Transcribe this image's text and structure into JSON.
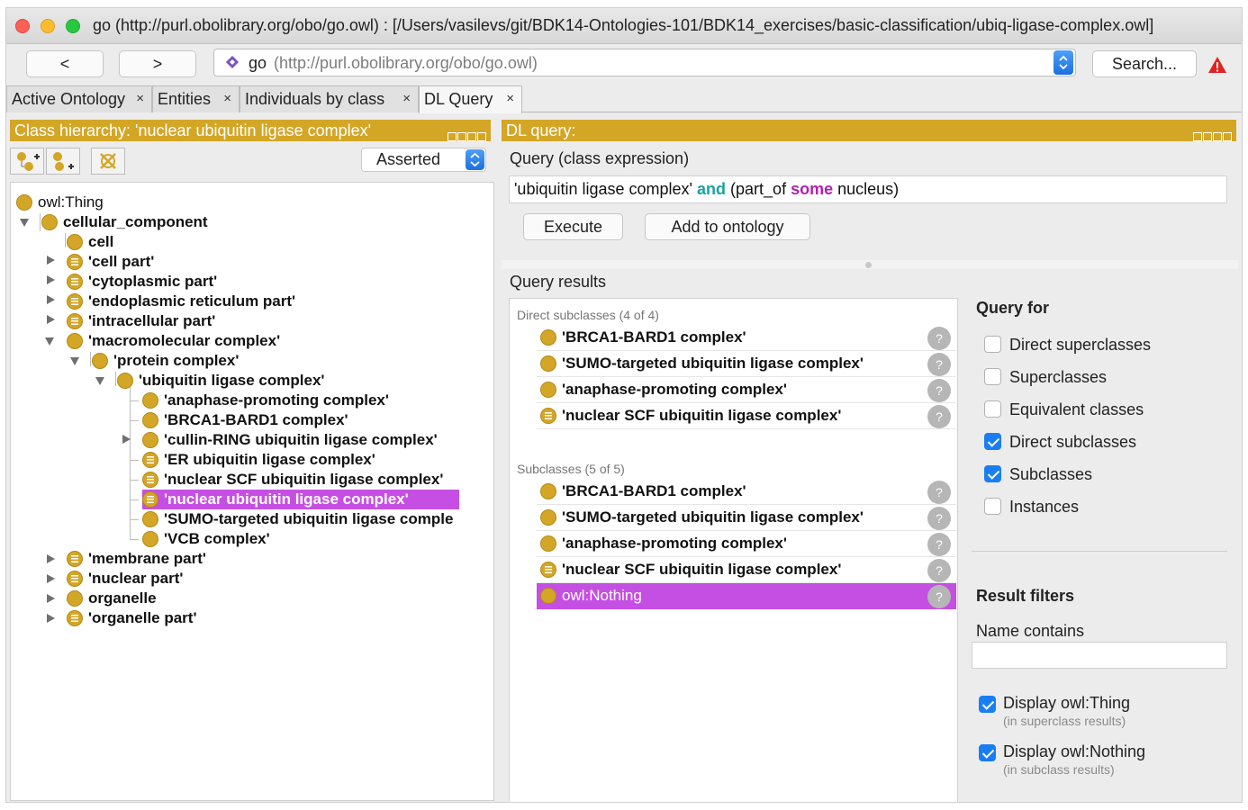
{
  "window": {
    "title": "go (http://purl.obolibrary.org/obo/go.owl)  : [/Users/vasilevs/git/BDK14-Ontologies-101/BDK14_exercises/basic-classification/ubiq-ligase-complex.owl]"
  },
  "nav": {
    "back_label": "<",
    "forward_label": ">",
    "ontology_name": "go",
    "ontology_iri": "(http://purl.obolibrary.org/obo/go.owl)",
    "search_label": "Search..."
  },
  "tabs": [
    {
      "label": "Active Ontology",
      "close": "×"
    },
    {
      "label": "Entities",
      "close": "×"
    },
    {
      "label": "Individuals by class",
      "close": "×"
    },
    {
      "label": "DL Query",
      "close": "×"
    }
  ],
  "class_hierarchy": {
    "header": "Class hierarchy: 'nuclear ubiquitin ligase complex'",
    "mode": "Asserted",
    "nodes": [
      {
        "label": "owl:Thing"
      },
      {
        "label": "cellular_component"
      },
      {
        "label": "cell"
      },
      {
        "label": "'cell part'"
      },
      {
        "label": "'cytoplasmic part'"
      },
      {
        "label": "'endoplasmic reticulum part'"
      },
      {
        "label": "'intracellular part'"
      },
      {
        "label": "'macromolecular complex'"
      },
      {
        "label": "'protein complex'"
      },
      {
        "label": "'ubiquitin ligase complex'"
      },
      {
        "label": "'anaphase-promoting complex'"
      },
      {
        "label": "'BRCA1-BARD1 complex'"
      },
      {
        "label": "'cullin-RING ubiquitin ligase complex'"
      },
      {
        "label": "'ER ubiquitin ligase complex'"
      },
      {
        "label": "'nuclear SCF ubiquitin ligase complex'"
      },
      {
        "label": "'nuclear ubiquitin ligase complex'"
      },
      {
        "label": "'SUMO-targeted ubiquitin ligase comple"
      },
      {
        "label": "'VCB complex'"
      },
      {
        "label": "'membrane part'"
      },
      {
        "label": "'nuclear part'"
      },
      {
        "label": "organelle"
      },
      {
        "label": "'organelle part'"
      }
    ]
  },
  "dl_query": {
    "header": "DL query:",
    "expression_label": "Query (class expression)",
    "expr_part1": "'ubiquitin ligase complex'",
    "expr_and": "and",
    "expr_part2": "(part_of",
    "expr_some": "some",
    "expr_part3": "nucleus)",
    "execute_label": "Execute",
    "add_label": "Add to ontology",
    "results_label": "Query results",
    "direct_subclasses_title": "Direct subclasses (4 of 4)",
    "direct_subclasses": [
      "'BRCA1-BARD1 complex'",
      "'SUMO-targeted ubiquitin ligase complex'",
      "'anaphase-promoting complex'",
      "'nuclear SCF ubiquitin ligase complex'"
    ],
    "subclasses_title": "Subclasses (5 of 5)",
    "subclasses": [
      "'BRCA1-BARD1 complex'",
      "'SUMO-targeted ubiquitin ligase complex'",
      "'anaphase-promoting complex'",
      "'nuclear SCF ubiquitin ligase complex'",
      "owl:Nothing"
    ],
    "help_glyph": "?"
  },
  "query_for": {
    "title": "Query for",
    "options": [
      {
        "label": "Direct superclasses",
        "checked": false
      },
      {
        "label": "Superclasses",
        "checked": false
      },
      {
        "label": "Equivalent classes",
        "checked": false
      },
      {
        "label": "Direct subclasses",
        "checked": true
      },
      {
        "label": "Subclasses",
        "checked": true
      },
      {
        "label": "Instances",
        "checked": false
      }
    ]
  },
  "result_filters": {
    "title": "Result filters",
    "name_contains_label": "Name contains",
    "name_contains_value": "",
    "display_thing_label": "Display owl:Thing",
    "display_thing_note": "(in superclass results)",
    "display_thing_checked": true,
    "display_nothing_label": "Display owl:Nothing",
    "display_nothing_note": "(in subclass results)",
    "display_nothing_checked": true
  },
  "colors": {
    "pane_header": "#d4a625",
    "selection": "#c64fe3",
    "class_icon": "#d4a628",
    "keyword_and": "#16a3a6",
    "keyword_some": "#b21fb2"
  }
}
